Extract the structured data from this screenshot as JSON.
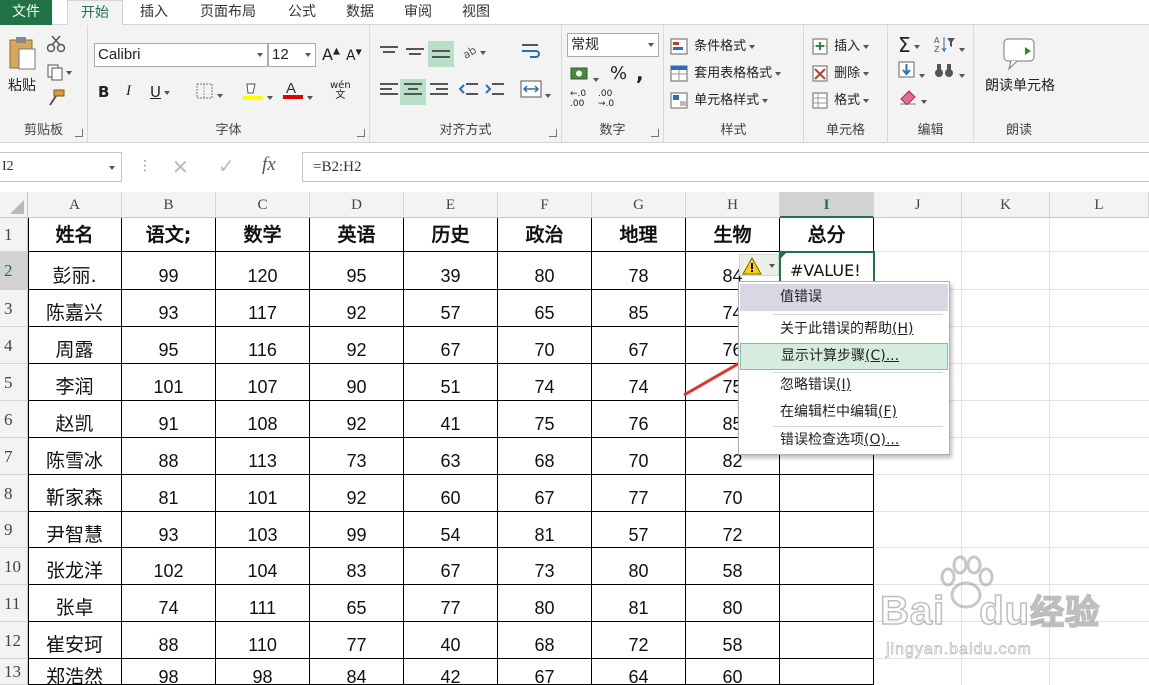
{
  "tabs": [
    "文件",
    "开始",
    "插入",
    "页面布局",
    "公式",
    "数据",
    "审阅",
    "视图"
  ],
  "ribbon": {
    "clipboard": {
      "paste": "粘贴",
      "label": "剪贴板"
    },
    "font": {
      "name": "Calibri",
      "size": "12",
      "label": "字体",
      "fill_color": "#ffff00",
      "font_color": "#e00000"
    },
    "align": {
      "label": "对齐方式"
    },
    "number": {
      "format": "常规",
      "label": "数字"
    },
    "styles": {
      "conditional": "条件格式",
      "table": "套用表格格式",
      "cell": "单元格样式",
      "label": "样式"
    },
    "cells": {
      "insert": "插入",
      "delete": "删除",
      "format": "格式",
      "label": "单元格"
    },
    "editing": {
      "label": "编辑"
    },
    "read": {
      "button": "朗读单元格",
      "label": "朗读"
    }
  },
  "formula_bar": {
    "name_box": "I2",
    "formula": "=B2:H2"
  },
  "grid": {
    "columns": [
      "A",
      "B",
      "C",
      "D",
      "E",
      "F",
      "G",
      "H",
      "I",
      "J",
      "K",
      "L"
    ],
    "rows": [
      "1",
      "2",
      "3",
      "4",
      "5",
      "6",
      "7",
      "8",
      "9",
      "10",
      "11",
      "12",
      "13"
    ],
    "headers": [
      "姓名",
      "语文;",
      "数学",
      "英语",
      "历史",
      "政治",
      "地理",
      "生物",
      "总分"
    ],
    "data": [
      [
        "彭丽.",
        "99",
        "120",
        "95",
        "39",
        "80",
        "78",
        "84",
        "#VALUE!"
      ],
      [
        "陈嘉兴",
        "93",
        "117",
        "92",
        "57",
        "65",
        "85",
        "74",
        ""
      ],
      [
        "周露",
        "95",
        "116",
        "92",
        "67",
        "70",
        "67",
        "76",
        ""
      ],
      [
        "李润",
        "101",
        "107",
        "90",
        "51",
        "74",
        "74",
        "75",
        ""
      ],
      [
        "赵凯",
        "91",
        "108",
        "92",
        "41",
        "75",
        "76",
        "85",
        ""
      ],
      [
        "陈雪冰",
        "88",
        "113",
        "73",
        "63",
        "68",
        "70",
        "82",
        ""
      ],
      [
        "靳家森",
        "81",
        "101",
        "92",
        "60",
        "67",
        "77",
        "70",
        ""
      ],
      [
        "尹智慧",
        "93",
        "103",
        "99",
        "54",
        "81",
        "57",
        "72",
        ""
      ],
      [
        "张龙洋",
        "102",
        "104",
        "83",
        "67",
        "73",
        "80",
        "58",
        ""
      ],
      [
        "张卓",
        "74",
        "111",
        "65",
        "77",
        "80",
        "81",
        "80",
        ""
      ],
      [
        "崔安珂",
        "88",
        "110",
        "77",
        "40",
        "68",
        "72",
        "58",
        ""
      ],
      [
        "郑浩然",
        "98",
        "98",
        "84",
        "42",
        "67",
        "64",
        "60",
        ""
      ]
    ]
  },
  "error_menu": {
    "title": "值错误",
    "items": [
      {
        "label": "关于此错误的帮助",
        "key": "(H)"
      },
      {
        "label": "显示计算步骤",
        "key": "(C)..."
      },
      {
        "label": "忽略错误",
        "key": "(I)"
      },
      {
        "label": "在编辑栏中编辑",
        "key": "(F)"
      },
      {
        "label": "错误检查选项",
        "key": "(O)..."
      }
    ]
  },
  "watermark": {
    "brand": "Bai",
    "brand2": "du",
    "brand3": "经验",
    "url": "jingyan.baidu.com"
  },
  "colors": {
    "accent": "#217346",
    "arrow": "#e0342a"
  }
}
